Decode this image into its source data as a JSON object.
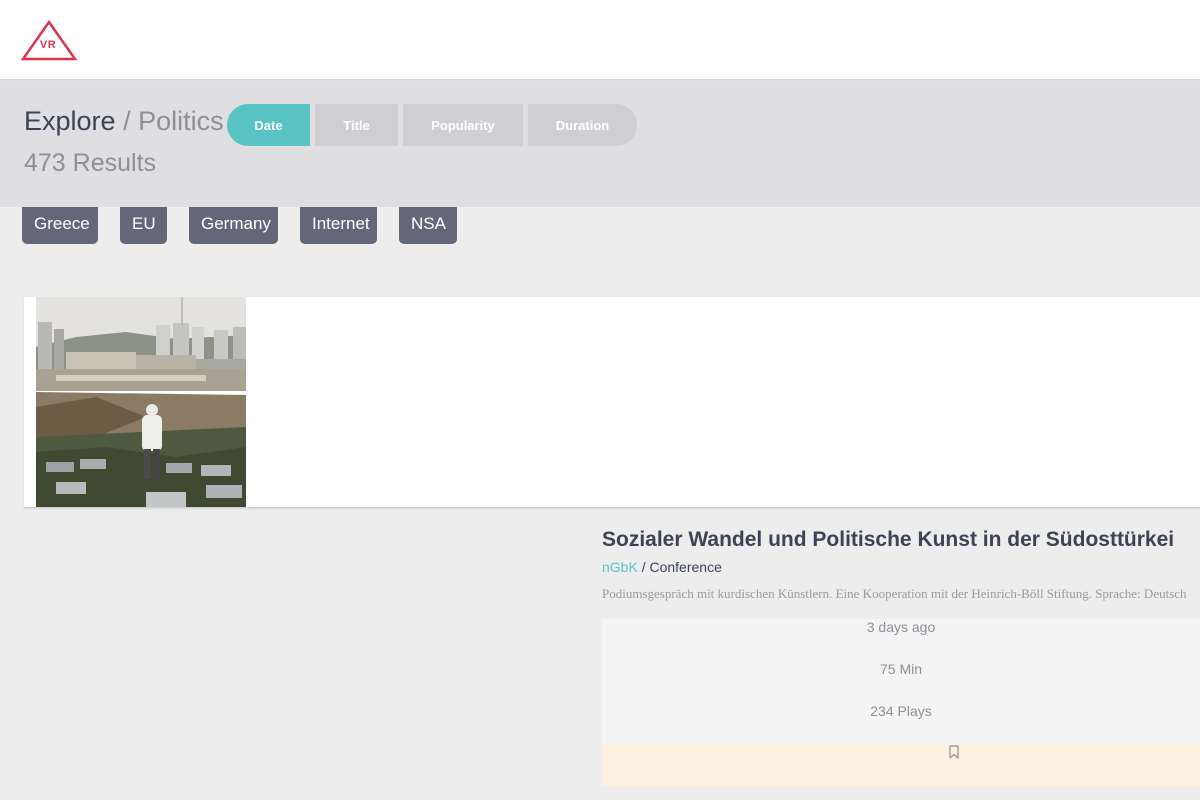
{
  "brand": {
    "logo_text": "VR",
    "accent": "#e0334c"
  },
  "breadcrumb": {
    "root": "Explore",
    "separator": "/",
    "current": "Politics"
  },
  "results": {
    "label": "473 Results"
  },
  "sort": {
    "options": [
      "Date",
      "Title",
      "Popularity",
      "Duration"
    ],
    "active": "Date",
    "active_color": "#59c3c3"
  },
  "tags": [
    "Greece",
    "EU",
    "Germany",
    "Internet",
    "NSA"
  ],
  "card": {
    "title": "Sozialer Wandel und Politische Kunst in der Südosttürkei",
    "organizer": "nGbK",
    "separator": " / ",
    "type": "Conference",
    "description": "Podiumsgespräch mit kurdischen Künstlern. Eine Kooperation mit der Heinrich-Böll Stiftung. Sprache: Deutsch",
    "stats": {
      "posted": "3 days ago",
      "duration": "75 Min",
      "plays": "234 Plays"
    },
    "bookmark_icon": "bookmark-icon",
    "thumbnail_icon": "photo-thumbnail"
  }
}
